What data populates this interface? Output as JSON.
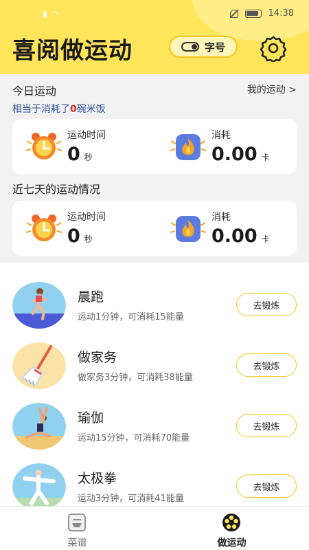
{
  "status_bar": {
    "time": "14:38"
  },
  "header": {
    "title": "喜阅做运动",
    "font_button_label": "字号"
  },
  "today": {
    "title": "今日运动",
    "link": "我的运动 >",
    "subtitle_prefix": "相当于消耗了",
    "subtitle_count": "0",
    "subtitle_suffix": "碗米饭",
    "time_label": "运动时间",
    "time_value": "0",
    "time_unit": "秒",
    "burn_label": "消耗",
    "burn_value": "0.00",
    "burn_unit": "卡"
  },
  "week": {
    "title": "近七天的运动情况",
    "time_label": "运动时间",
    "time_value": "0",
    "time_unit": "秒",
    "burn_label": "消耗",
    "burn_value": "0.00",
    "burn_unit": "卡"
  },
  "exercises": [
    {
      "name": "晨跑",
      "desc": "运动1分钟，可消耗15能量",
      "button": "去锻炼"
    },
    {
      "name": "做家务",
      "desc": "做家务3分钟，可消耗38能量",
      "button": "去锻炼"
    },
    {
      "name": "瑜伽",
      "desc": "运动15分钟，可消耗70能量",
      "button": "去锻炼"
    },
    {
      "name": "太极拳",
      "desc": "运动3分钟，可消耗41能量",
      "button": "去锻炼"
    }
  ],
  "tabs": [
    {
      "label": "菜谱",
      "icon": "recipe-icon",
      "active": false
    },
    {
      "label": "做运动",
      "icon": "exercise-icon",
      "active": true
    }
  ],
  "colors": {
    "brand_yellow": "#ffe55a",
    "accent_red": "#e4232b",
    "link_blue": "#2a4e9c"
  }
}
